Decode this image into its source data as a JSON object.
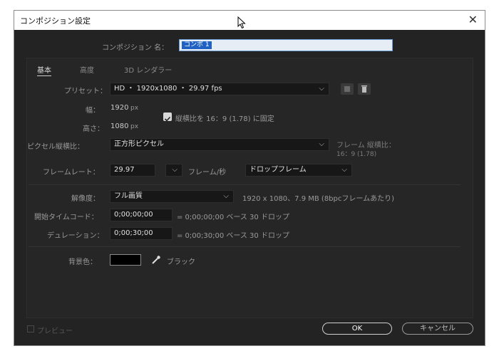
{
  "window": {
    "title": "コンポジション設定"
  },
  "comp_name": {
    "label": "コンポジション 名：",
    "value": "コンポ 1"
  },
  "tabs": [
    {
      "label": "基本"
    },
    {
      "label": "高度"
    },
    {
      "label": "3D レンダラー"
    }
  ],
  "preset": {
    "label": "プリセット：",
    "value": "HD ・ 1920x1080 ・ 29.97 fps"
  },
  "width": {
    "label": "幅：",
    "value": "1920",
    "unit": "px"
  },
  "height": {
    "label": "高さ：",
    "value": "1080",
    "unit": "px"
  },
  "lock_aspect": {
    "label": "縦横比を 16：9 (1.78) に固定",
    "checked": true
  },
  "pixel_aspect": {
    "label": "ピクセル縦横比：",
    "value": "正方形ピクセル",
    "frame_aspect_label": "フレーム 縦横比：",
    "frame_aspect_value": "16：9 (1.78)"
  },
  "frame_rate": {
    "label": "フレームレート：",
    "value": "29.97",
    "unit": "フレーム/秒",
    "drop_frame": "ドロップフレーム"
  },
  "resolution": {
    "label": "解像度：",
    "value": "フル画質",
    "info": "1920 x 1080、7.9 MB (8bpcフレームあたり)"
  },
  "start_timecode": {
    "label": "開始タイムコード：",
    "value": "0;00;00;00",
    "info": "= 0;00;00;00 ベース 30 ドロップ"
  },
  "duration": {
    "label": "デュレーション：",
    "value": "0;00;30;00",
    "info": "= 0;00;30;00 ベース 30 ドロップ"
  },
  "background": {
    "label": "背景色：",
    "color": "#000000",
    "name": "ブラック"
  },
  "footer": {
    "preview_label": "プレビュー",
    "ok_label": "OK",
    "cancel_label": "キャンセル"
  },
  "colors": {
    "dialog_bg": "#232323",
    "accent_blue": "#2d8ceb",
    "selection": "#1f62c4"
  }
}
